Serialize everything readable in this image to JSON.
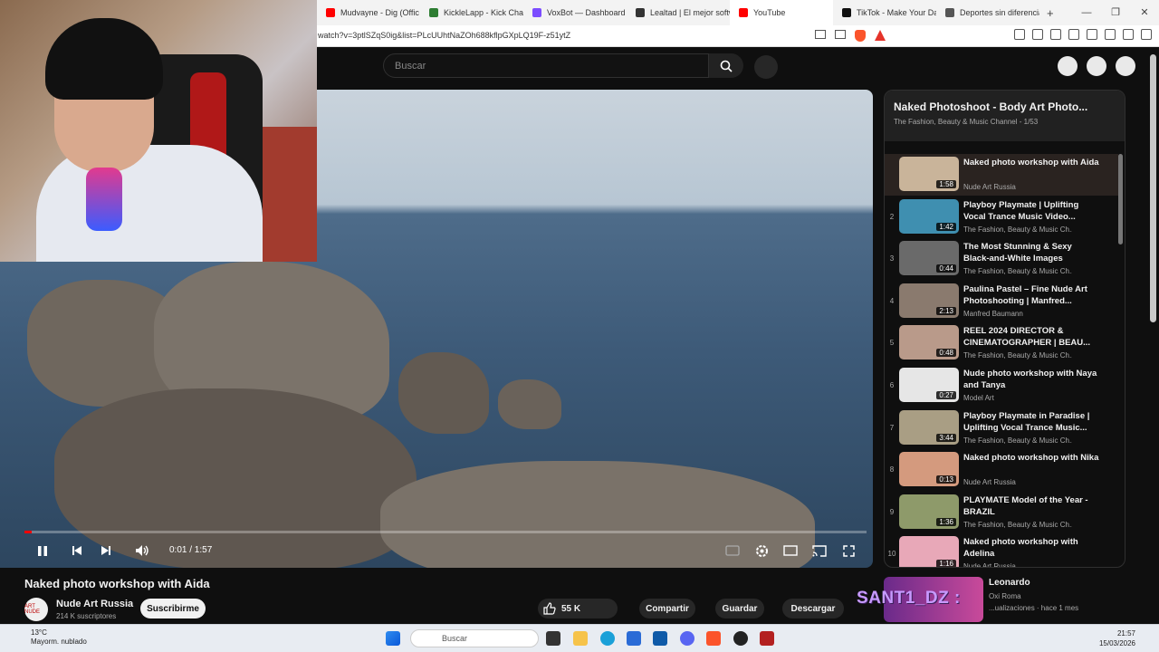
{
  "browser": {
    "tabs": [
      {
        "label": "Mudvayne - Dig (Offic",
        "color": "#ff0000"
      },
      {
        "label": "KickleLapp - Kick Chat",
        "color": "#2e7d32"
      },
      {
        "label": "VoxBot — Dashboard",
        "color": "#7c4dff"
      },
      {
        "label": "Lealtad | El mejor softw",
        "color": "#333333"
      },
      {
        "label": "YouTube",
        "color": "#ff0000"
      },
      {
        "label": "TikTok - Make Your Da",
        "color": "#111111"
      },
      {
        "label": "Deportes sin diferencia",
        "color": "#555555"
      }
    ],
    "new_tab": "+",
    "url": "watch?v=3ptlSZqS0ig&list=PLcUUhtNaZOh688kflpGXpLQ19F-z51ytZ"
  },
  "youtube": {
    "search_placeholder": "Buscar"
  },
  "player": {
    "time": "0:01 / 1:57",
    "progress": 0.009
  },
  "video": {
    "title": "Naked photo workshop with Aida",
    "channel": "Nude Art Russia",
    "subscribers": "214 K suscriptores",
    "avatar_text": "ART NUDE",
    "subscribe_label": "Suscribirme",
    "likes": "55 K",
    "share_label": "Compartir",
    "save_label": "Guardar",
    "download_label": "Descargar"
  },
  "playlist": {
    "title": "Naked Photoshoot - Body Art Photo...",
    "subtitle": "The Fashion, Beauty & Music Channel - 1/53",
    "items": [
      {
        "index": "",
        "title": "Naked photo workshop with Aida",
        "channel": "Nude Art Russia",
        "duration": "1:58",
        "thumb": "#c9b49a"
      },
      {
        "index": "2",
        "title": "Playboy Playmate | Uplifting Vocal Trance Music Video...",
        "channel": "The Fashion, Beauty & Music Ch...",
        "duration": "1:42",
        "thumb": "#3f8fb0"
      },
      {
        "index": "3",
        "title": "The Most Stunning & Sexy Black-and-White Images",
        "channel": "The Fashion, Beauty & Music Ch...",
        "duration": "0:44",
        "thumb": "#6a6a6a"
      },
      {
        "index": "4",
        "title": "Paulina Pastel – Fine Nude Art Photoshooting | Manfred...",
        "channel": "Manfred Baumann",
        "duration": "2:13",
        "thumb": "#8a7a6e"
      },
      {
        "index": "5",
        "title": "REEL 2024 DIRECTOR & CINEMATOGRAPHER | BEAU...",
        "channel": "The Fashion, Beauty & Music Ch...",
        "duration": "0:48",
        "thumb": "#b99a8a"
      },
      {
        "index": "6",
        "title": "Nude photo workshop with Naya and Tanya",
        "channel": "Model Art",
        "duration": "0:27",
        "thumb": "#e6e6e6"
      },
      {
        "index": "7",
        "title": "Playboy Playmate in Paradise | Uplifting Vocal Trance Music...",
        "channel": "The Fashion, Beauty & Music Ch...",
        "duration": "3:44",
        "thumb": "#a99e84"
      },
      {
        "index": "8",
        "title": "Naked photo workshop with Nika",
        "channel": "Nude Art Russia",
        "duration": "0:13",
        "thumb": "#d49a7e"
      },
      {
        "index": "9",
        "title": "PLAYMATE Model of the Year - BRAZIL",
        "channel": "The Fashion, Beauty & Music Ch...",
        "duration": "1:36",
        "thumb": "#8e9a6a"
      },
      {
        "index": "10",
        "title": "Naked photo workshop with Adelina",
        "channel": "Nude Art Russia",
        "duration": "1:16",
        "thumb": "#e8a8b8"
      }
    ]
  },
  "recommendation": {
    "title": "Leonardo",
    "channel": "Oxi Roma",
    "meta": "...ualizaciones · hace 1 mes"
  },
  "stream_overlay": {
    "tag": "SANT1_DZ :"
  },
  "taskbar": {
    "weather_temp": "13°C",
    "weather_desc": "Mayorm. nublado",
    "search_label": "Buscar",
    "time": "21:57",
    "date": "15/03/2026"
  }
}
